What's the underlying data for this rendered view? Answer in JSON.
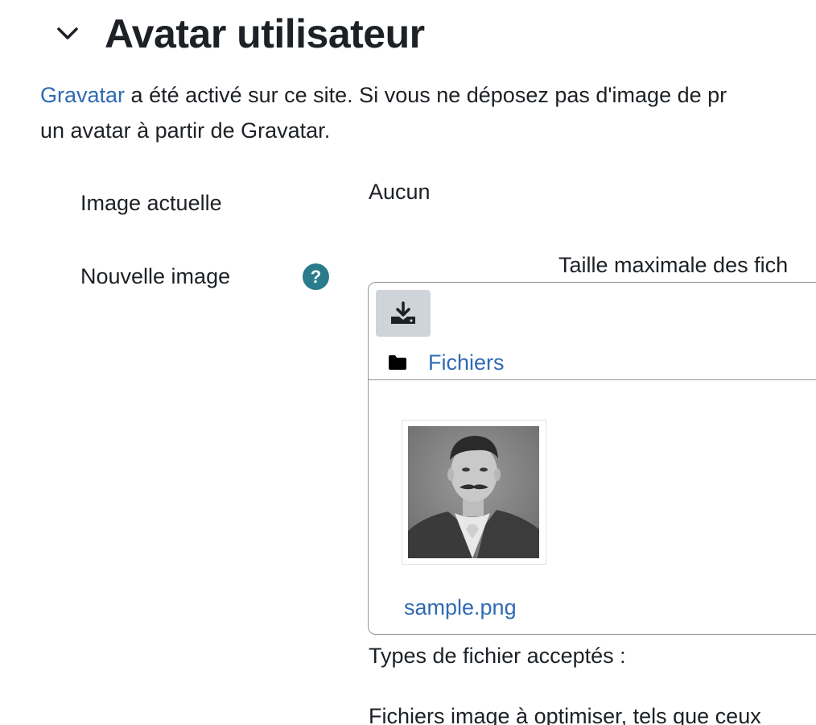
{
  "section": {
    "title": "Avatar utilisateur",
    "expanded": true
  },
  "intro": {
    "link_text": "Gravatar",
    "text_line1": " a été activé sur ce site. Si vous ne déposez pas d'image de pr",
    "text_line2": "un avatar à partir de Gravatar."
  },
  "current_image": {
    "label": "Image actuelle",
    "value": "Aucun"
  },
  "new_image": {
    "label": "Nouvelle image",
    "help_icon": "question-circle-icon",
    "help_glyph": "?",
    "max_size_text": "Taille maximale des fich"
  },
  "filemanager": {
    "toolbar_icon": "download-icon",
    "path_icon": "folder-icon",
    "path_label": "Fichiers",
    "files": [
      {
        "name": "sample.png"
      }
    ]
  },
  "accepted_types": {
    "label": "Types de fichier acceptés :",
    "description": "Fichiers image à optimiser, tels que ceux"
  },
  "colors": {
    "link": "#2f6ab3",
    "help_icon_bg": "#2a7b8c",
    "toolbar_button_bg": "#ced4da",
    "border": "#8f959e"
  }
}
